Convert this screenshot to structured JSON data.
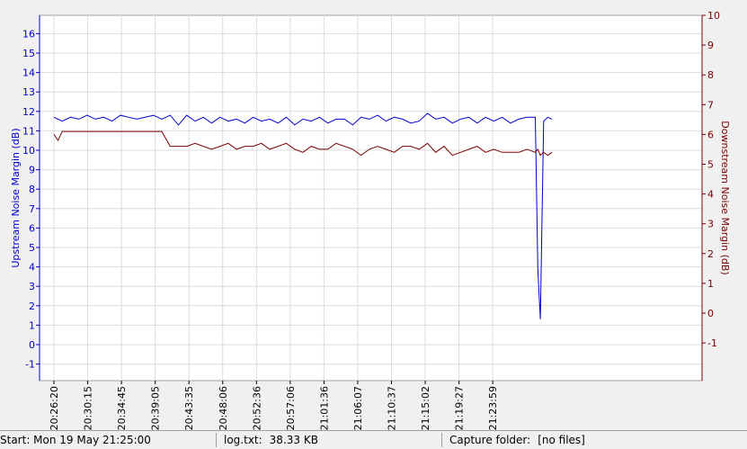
{
  "chart_data": {
    "type": "line",
    "xlabel": "",
    "ylabel_left": "Upstream Noise Margin (dB)",
    "ylabel_right": "Downstream Noise Margin (dB)",
    "y_left_range": [
      -2,
      17
    ],
    "y_right_range": [
      -2,
      10
    ],
    "y_left_ticks": [
      "-1",
      "0",
      "1",
      "2",
      "3",
      "4",
      "5",
      "6",
      "7",
      "8",
      "9",
      "10",
      "11",
      "12",
      "13",
      "14",
      "15",
      "16"
    ],
    "y_right_ticks": [
      "-1",
      "0",
      "1",
      "2",
      "3",
      "4",
      "5",
      "6",
      "7",
      "8",
      "9",
      "10"
    ],
    "x_tick_labels": [
      "20:26:20",
      "20:30:15",
      "20:34:45",
      "20:39:05",
      "20:43:35",
      "20:48:06",
      "20:52:36",
      "20:57:06",
      "21:01:36",
      "21:06:07",
      "21:10:37",
      "21:15:02",
      "21:19:27",
      "21:23:59"
    ],
    "x_range_minutes": [
      -2,
      65
    ],
    "grid": true,
    "series": [
      {
        "name": "Upstream Noise Margin (dB)",
        "axis": "left",
        "color": "#0000cc",
        "x_minutes": [
          0,
          1,
          2,
          3,
          4,
          5,
          6,
          7,
          8,
          9,
          10,
          11,
          12,
          13,
          14,
          15,
          16,
          17,
          18,
          19,
          20,
          21,
          22,
          23,
          24,
          25,
          26,
          27,
          28,
          29,
          30,
          31,
          32,
          33,
          34,
          35,
          36,
          37,
          38,
          39,
          40,
          41,
          42,
          43,
          44,
          45,
          46,
          47,
          48,
          49,
          50,
          51,
          52,
          53,
          54,
          55,
          56,
          57,
          58,
          58.3,
          58.6,
          59,
          59.5,
          60
        ],
        "values": [
          11.7,
          11.5,
          11.7,
          11.6,
          11.8,
          11.6,
          11.7,
          11.5,
          11.8,
          11.7,
          11.6,
          11.7,
          11.8,
          11.6,
          11.8,
          11.3,
          11.8,
          11.5,
          11.7,
          11.4,
          11.7,
          11.5,
          11.6,
          11.4,
          11.7,
          11.5,
          11.6,
          11.4,
          11.7,
          11.3,
          11.6,
          11.5,
          11.7,
          11.4,
          11.6,
          11.6,
          11.3,
          11.7,
          11.6,
          11.8,
          11.5,
          11.7,
          11.6,
          11.4,
          11.5,
          11.9,
          11.6,
          11.7,
          11.4,
          11.6,
          11.7,
          11.4,
          11.7,
          11.5,
          11.7,
          11.4,
          11.6,
          11.7,
          11.7,
          3.9,
          1.3,
          11.5,
          11.7,
          11.6
        ]
      },
      {
        "name": "Downstream Noise Margin (dB)",
        "axis": "right",
        "color": "#7a0000",
        "x_minutes": [
          0,
          0.5,
          1,
          2,
          3,
          4,
          5,
          6,
          7,
          8,
          9,
          10,
          11,
          12,
          13,
          14,
          15,
          16,
          17,
          18,
          19,
          20,
          21,
          22,
          23,
          24,
          25,
          26,
          27,
          28,
          29,
          30,
          31,
          32,
          33,
          34,
          35,
          36,
          37,
          38,
          39,
          40,
          41,
          42,
          43,
          44,
          45,
          46,
          47,
          48,
          49,
          50,
          51,
          52,
          53,
          54,
          55,
          56,
          57,
          58,
          58.3,
          58.6,
          59,
          59.5,
          60
        ],
        "values": [
          6.0,
          5.8,
          6.1,
          6.1,
          6.1,
          6.1,
          6.1,
          6.1,
          6.1,
          6.1,
          6.1,
          6.1,
          6.1,
          6.1,
          6.1,
          5.6,
          5.6,
          5.6,
          5.7,
          5.6,
          5.5,
          5.6,
          5.7,
          5.5,
          5.6,
          5.6,
          5.7,
          5.5,
          5.6,
          5.7,
          5.5,
          5.4,
          5.6,
          5.5,
          5.5,
          5.7,
          5.6,
          5.5,
          5.3,
          5.5,
          5.6,
          5.5,
          5.4,
          5.6,
          5.6,
          5.5,
          5.7,
          5.4,
          5.6,
          5.3,
          5.4,
          5.5,
          5.6,
          5.4,
          5.5,
          5.4,
          5.4,
          5.4,
          5.5,
          5.4,
          5.5,
          5.3,
          5.4,
          5.3,
          5.4
        ]
      }
    ]
  },
  "status_bar": {
    "start_text": "Start: Mon 19 May 21:25:00",
    "log_label": "log.txt:",
    "log_size": "38.33 KB",
    "capture_label": "Capture folder:",
    "capture_value": "[no files]"
  }
}
